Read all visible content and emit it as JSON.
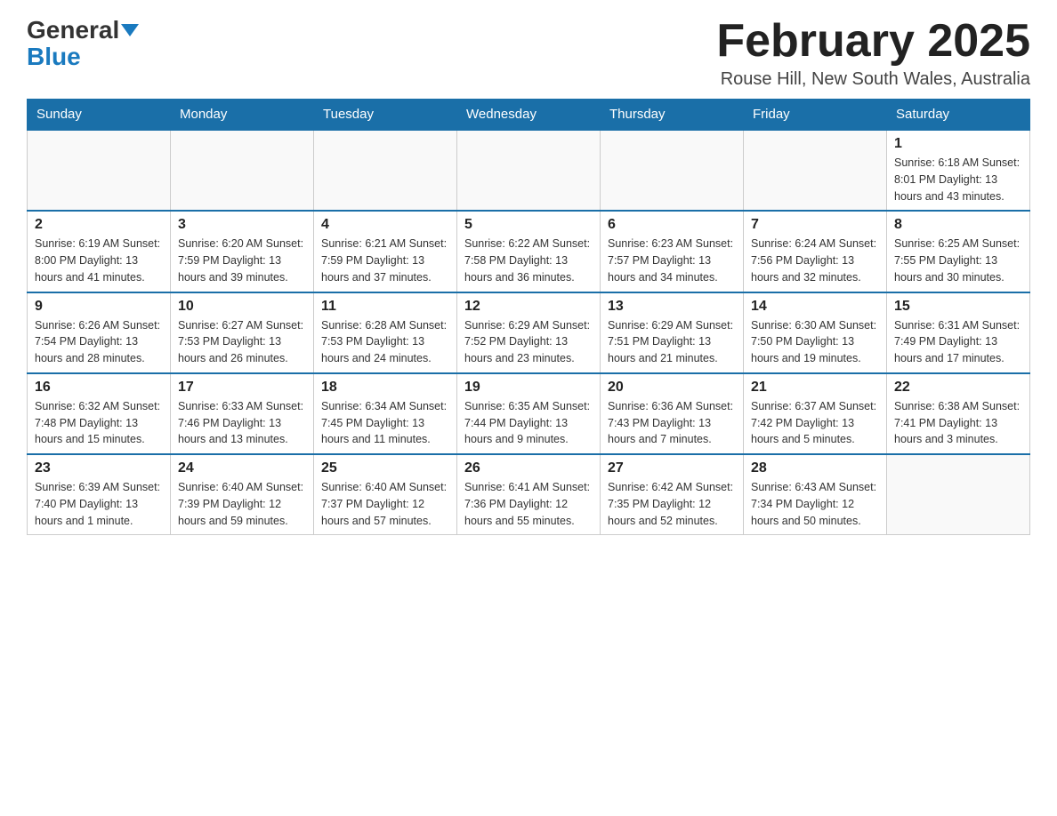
{
  "header": {
    "logo_line1": "General",
    "logo_line2": "Blue",
    "month_title": "February 2025",
    "location": "Rouse Hill, New South Wales, Australia"
  },
  "weekdays": [
    "Sunday",
    "Monday",
    "Tuesday",
    "Wednesday",
    "Thursday",
    "Friday",
    "Saturday"
  ],
  "weeks": [
    [
      {
        "day": "",
        "info": ""
      },
      {
        "day": "",
        "info": ""
      },
      {
        "day": "",
        "info": ""
      },
      {
        "day": "",
        "info": ""
      },
      {
        "day": "",
        "info": ""
      },
      {
        "day": "",
        "info": ""
      },
      {
        "day": "1",
        "info": "Sunrise: 6:18 AM\nSunset: 8:01 PM\nDaylight: 13 hours\nand 43 minutes."
      }
    ],
    [
      {
        "day": "2",
        "info": "Sunrise: 6:19 AM\nSunset: 8:00 PM\nDaylight: 13 hours\nand 41 minutes."
      },
      {
        "day": "3",
        "info": "Sunrise: 6:20 AM\nSunset: 7:59 PM\nDaylight: 13 hours\nand 39 minutes."
      },
      {
        "day": "4",
        "info": "Sunrise: 6:21 AM\nSunset: 7:59 PM\nDaylight: 13 hours\nand 37 minutes."
      },
      {
        "day": "5",
        "info": "Sunrise: 6:22 AM\nSunset: 7:58 PM\nDaylight: 13 hours\nand 36 minutes."
      },
      {
        "day": "6",
        "info": "Sunrise: 6:23 AM\nSunset: 7:57 PM\nDaylight: 13 hours\nand 34 minutes."
      },
      {
        "day": "7",
        "info": "Sunrise: 6:24 AM\nSunset: 7:56 PM\nDaylight: 13 hours\nand 32 minutes."
      },
      {
        "day": "8",
        "info": "Sunrise: 6:25 AM\nSunset: 7:55 PM\nDaylight: 13 hours\nand 30 minutes."
      }
    ],
    [
      {
        "day": "9",
        "info": "Sunrise: 6:26 AM\nSunset: 7:54 PM\nDaylight: 13 hours\nand 28 minutes."
      },
      {
        "day": "10",
        "info": "Sunrise: 6:27 AM\nSunset: 7:53 PM\nDaylight: 13 hours\nand 26 minutes."
      },
      {
        "day": "11",
        "info": "Sunrise: 6:28 AM\nSunset: 7:53 PM\nDaylight: 13 hours\nand 24 minutes."
      },
      {
        "day": "12",
        "info": "Sunrise: 6:29 AM\nSunset: 7:52 PM\nDaylight: 13 hours\nand 23 minutes."
      },
      {
        "day": "13",
        "info": "Sunrise: 6:29 AM\nSunset: 7:51 PM\nDaylight: 13 hours\nand 21 minutes."
      },
      {
        "day": "14",
        "info": "Sunrise: 6:30 AM\nSunset: 7:50 PM\nDaylight: 13 hours\nand 19 minutes."
      },
      {
        "day": "15",
        "info": "Sunrise: 6:31 AM\nSunset: 7:49 PM\nDaylight: 13 hours\nand 17 minutes."
      }
    ],
    [
      {
        "day": "16",
        "info": "Sunrise: 6:32 AM\nSunset: 7:48 PM\nDaylight: 13 hours\nand 15 minutes."
      },
      {
        "day": "17",
        "info": "Sunrise: 6:33 AM\nSunset: 7:46 PM\nDaylight: 13 hours\nand 13 minutes."
      },
      {
        "day": "18",
        "info": "Sunrise: 6:34 AM\nSunset: 7:45 PM\nDaylight: 13 hours\nand 11 minutes."
      },
      {
        "day": "19",
        "info": "Sunrise: 6:35 AM\nSunset: 7:44 PM\nDaylight: 13 hours\nand 9 minutes."
      },
      {
        "day": "20",
        "info": "Sunrise: 6:36 AM\nSunset: 7:43 PM\nDaylight: 13 hours\nand 7 minutes."
      },
      {
        "day": "21",
        "info": "Sunrise: 6:37 AM\nSunset: 7:42 PM\nDaylight: 13 hours\nand 5 minutes."
      },
      {
        "day": "22",
        "info": "Sunrise: 6:38 AM\nSunset: 7:41 PM\nDaylight: 13 hours\nand 3 minutes."
      }
    ],
    [
      {
        "day": "23",
        "info": "Sunrise: 6:39 AM\nSunset: 7:40 PM\nDaylight: 13 hours\nand 1 minute."
      },
      {
        "day": "24",
        "info": "Sunrise: 6:40 AM\nSunset: 7:39 PM\nDaylight: 12 hours\nand 59 minutes."
      },
      {
        "day": "25",
        "info": "Sunrise: 6:40 AM\nSunset: 7:37 PM\nDaylight: 12 hours\nand 57 minutes."
      },
      {
        "day": "26",
        "info": "Sunrise: 6:41 AM\nSunset: 7:36 PM\nDaylight: 12 hours\nand 55 minutes."
      },
      {
        "day": "27",
        "info": "Sunrise: 6:42 AM\nSunset: 7:35 PM\nDaylight: 12 hours\nand 52 minutes."
      },
      {
        "day": "28",
        "info": "Sunrise: 6:43 AM\nSunset: 7:34 PM\nDaylight: 12 hours\nand 50 minutes."
      },
      {
        "day": "",
        "info": ""
      }
    ]
  ]
}
